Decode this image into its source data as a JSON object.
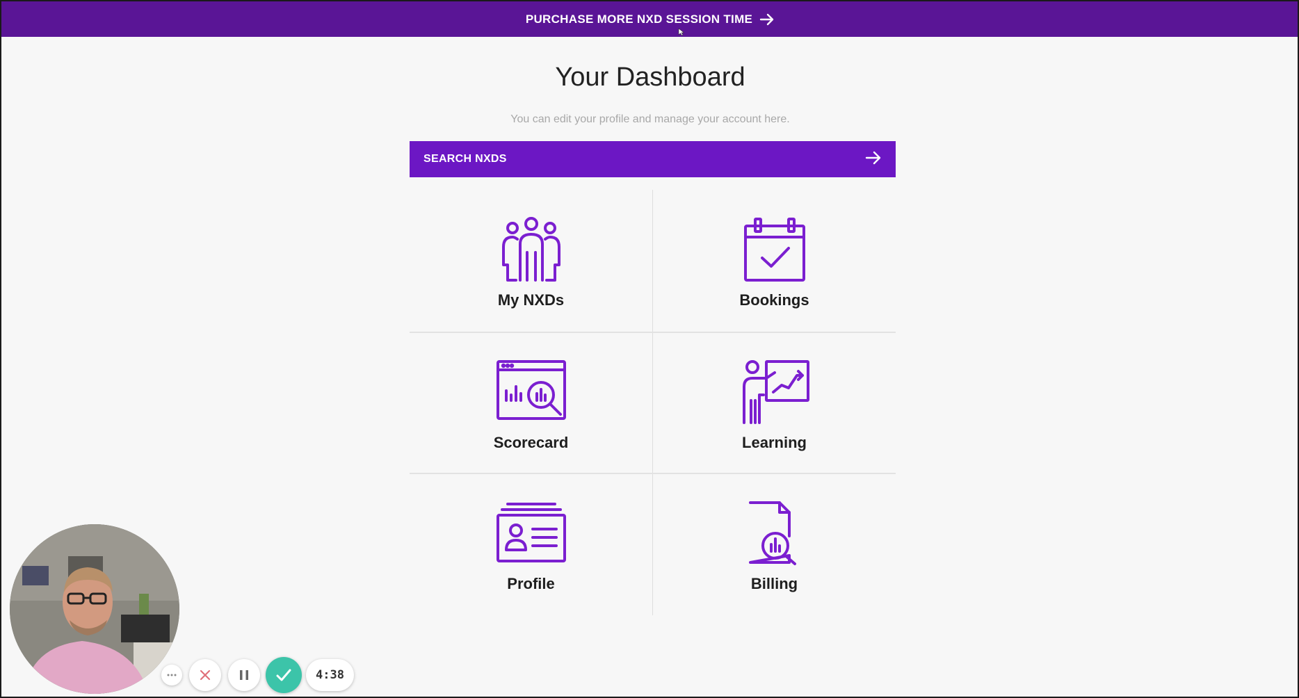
{
  "banner": {
    "text": "PURCHASE MORE NXD SESSION TIME",
    "arrow_icon": "arrow-right-icon",
    "color": "#5a1596"
  },
  "header": {
    "title": "Your Dashboard",
    "subtitle": "You can edit your profile and manage your account here."
  },
  "search": {
    "label": "SEARCH NXDS",
    "arrow_icon": "arrow-right-icon",
    "color": "#6c17c4"
  },
  "tiles": [
    {
      "label": "My NXDs",
      "icon": "people-group-icon"
    },
    {
      "label": "Bookings",
      "icon": "calendar-check-icon"
    },
    {
      "label": "Scorecard",
      "icon": "analytics-window-icon"
    },
    {
      "label": "Learning",
      "icon": "presenter-chart-icon"
    },
    {
      "label": "Profile",
      "icon": "id-card-icon"
    },
    {
      "label": "Billing",
      "icon": "document-search-icon"
    }
  ],
  "accent_color": "#7b1fd0",
  "recorder": {
    "timer": "4:38",
    "more_icon": "ellipsis-icon",
    "cancel_icon": "close-icon",
    "pause_icon": "pause-icon",
    "done_icon": "check-icon",
    "done_color": "#3cc4a9"
  }
}
